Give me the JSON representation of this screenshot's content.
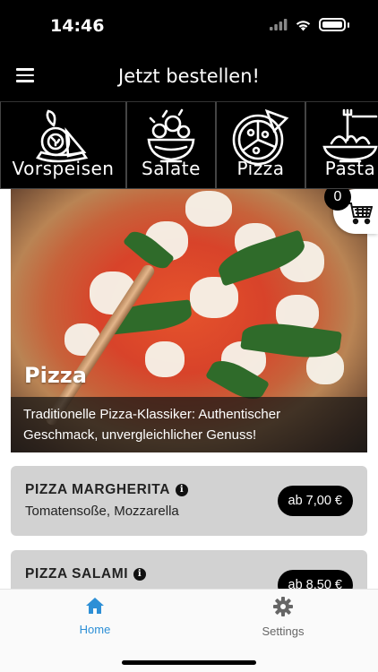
{
  "status_bar": {
    "time": "14:46"
  },
  "app_bar": {
    "title": "Jetzt bestellen!"
  },
  "categories": [
    {
      "label": "Vorspeisen",
      "icon": "appetizer-icon"
    },
    {
      "label": "Salate",
      "icon": "salad-bowl-icon"
    },
    {
      "label": "Pizza",
      "icon": "pizza-icon"
    },
    {
      "label": "Pasta",
      "icon": "pasta-icon"
    }
  ],
  "cart": {
    "count": "0"
  },
  "hero": {
    "title": "Pizza",
    "caption": "Traditionelle Pizza-Klassiker: Authentischer Geschmack, unvergleichlicher Genuss!"
  },
  "products": [
    {
      "name": "PIZZA MARGHERITA",
      "description": "Tomatensoße, Mozzarella",
      "price": "ab 7,00 €"
    },
    {
      "name": "PIZZA SALAMI",
      "description": "",
      "price": "ab 8,50 €"
    }
  ],
  "tabs": [
    {
      "label": "Home",
      "icon": "home-icon",
      "active": true
    },
    {
      "label": "Settings",
      "icon": "gear-icon",
      "active": false
    }
  ],
  "colors": {
    "accent": "#2d8fd6",
    "price_pill": "#000000",
    "card_bg": "#d2d2d2"
  }
}
